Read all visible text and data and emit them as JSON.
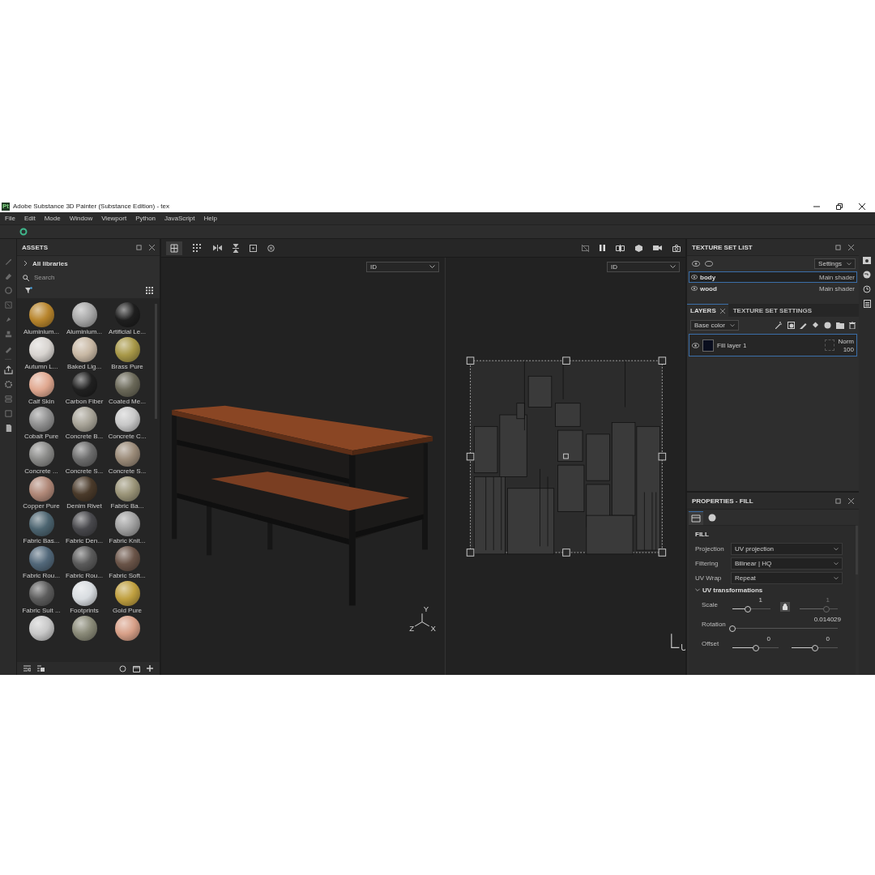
{
  "window": {
    "title": "Adobe Substance 3D Painter (Substance Edition) - tex",
    "app_badge": "Pt"
  },
  "menu": [
    "File",
    "Edit",
    "Mode",
    "Window",
    "Viewport",
    "Python",
    "JavaScript",
    "Help"
  ],
  "assets": {
    "title": "ASSETS",
    "library": "All libraries",
    "search": {
      "placeholder": "Search"
    },
    "items": [
      {
        "label": "Aluminium...",
        "color": "#b8852c"
      },
      {
        "label": "Aluminium...",
        "color": "#a8a8a8"
      },
      {
        "label": "Artificial Le...",
        "color": "#1e1e1e"
      },
      {
        "label": "Autumn L...",
        "color": "#d8d4d0"
      },
      {
        "label": "Baked Lig...",
        "color": "#c8b8a4"
      },
      {
        "label": "Brass Pure",
        "color": "#a89848"
      },
      {
        "label": "Calf Skin",
        "color": "#e0a890"
      },
      {
        "label": "Carbon Fiber",
        "color": "#202020"
      },
      {
        "label": "Coated Me...",
        "color": "#6a6858"
      },
      {
        "label": "Cobalt Pure",
        "color": "#909090"
      },
      {
        "label": "Concrete B...",
        "color": "#a8a498"
      },
      {
        "label": "Concrete C...",
        "color": "#c8c8c8"
      },
      {
        "label": "Concrete ...",
        "color": "#8a8a88"
      },
      {
        "label": "Concrete S...",
        "color": "#6c6c6c"
      },
      {
        "label": "Concrete S...",
        "color": "#9a8a78"
      },
      {
        "label": "Copper Pure",
        "color": "#b08878"
      },
      {
        "label": "Denim Rivet",
        "color": "#4a3a2a"
      },
      {
        "label": "Fabric Ba...",
        "color": "#9a9478"
      },
      {
        "label": "Fabric Bas...",
        "color": "#4c6470"
      },
      {
        "label": "Fabric Den...",
        "color": "#48484c"
      },
      {
        "label": "Fabric Knit...",
        "color": "#a0a0a0"
      },
      {
        "label": "Fabric Rou...",
        "color": "#52687a"
      },
      {
        "label": "Fabric Rou...",
        "color": "#5a5a5a"
      },
      {
        "label": "Fabric Soft...",
        "color": "#6a5448"
      },
      {
        "label": "Fabric Suit ...",
        "color": "#5c5c5c"
      },
      {
        "label": "Footprints",
        "color": "#d8dce0"
      },
      {
        "label": "Gold Pure",
        "color": "#c0a040"
      },
      {
        "color": "#c8c8c8"
      },
      {
        "color": "#8a8a78"
      },
      {
        "color": "#d8a088"
      }
    ]
  },
  "viewports": [
    {
      "dropdown": "ID",
      "axes": [
        "Z",
        "X",
        "Y"
      ]
    },
    {
      "dropdown": "ID",
      "axes": [
        "U"
      ]
    }
  ],
  "texture_set_list": {
    "title": "TEXTURE SET LIST",
    "settings": "Settings",
    "rows": [
      {
        "name": "body",
        "shader": "Main shader",
        "selected": true
      },
      {
        "name": "wood",
        "shader": "Main shader",
        "selected": false
      }
    ]
  },
  "layers": {
    "tabs": [
      {
        "label": "LAYERS",
        "selected": true,
        "closable": true
      },
      {
        "label": "TEXTURE SET SETTINGS",
        "selected": false,
        "closable": false
      }
    ],
    "channel": "Base color",
    "layer": {
      "name": "Fill layer 1",
      "blend": "Norm",
      "opacity": "100"
    }
  },
  "properties": {
    "title": "PROPERTIES - FILL",
    "section": "FILL",
    "fields": [
      {
        "label": "Projection",
        "value": "UV projection"
      },
      {
        "label": "Filtering",
        "value": "Bilinear | HQ"
      },
      {
        "label": "UV Wrap",
        "value": "Repeat"
      }
    ],
    "group": {
      "title": "UV transformations",
      "expanded": true
    },
    "scale": {
      "label": "Scale",
      "values": [
        {
          "reading": "1",
          "level": 0.4,
          "disabled": false
        },
        {
          "reading": "1",
          "level": 0.7,
          "disabled": true
        }
      ]
    },
    "rotation": {
      "label": "Rotation",
      "reading": "0.014029",
      "level": 0
    },
    "offset": {
      "label": "Offset",
      "values": [
        {
          "reading": "0",
          "level": 0.5,
          "disabled": false
        },
        {
          "reading": "0",
          "level": 0.5,
          "disabled": false
        }
      ]
    }
  }
}
